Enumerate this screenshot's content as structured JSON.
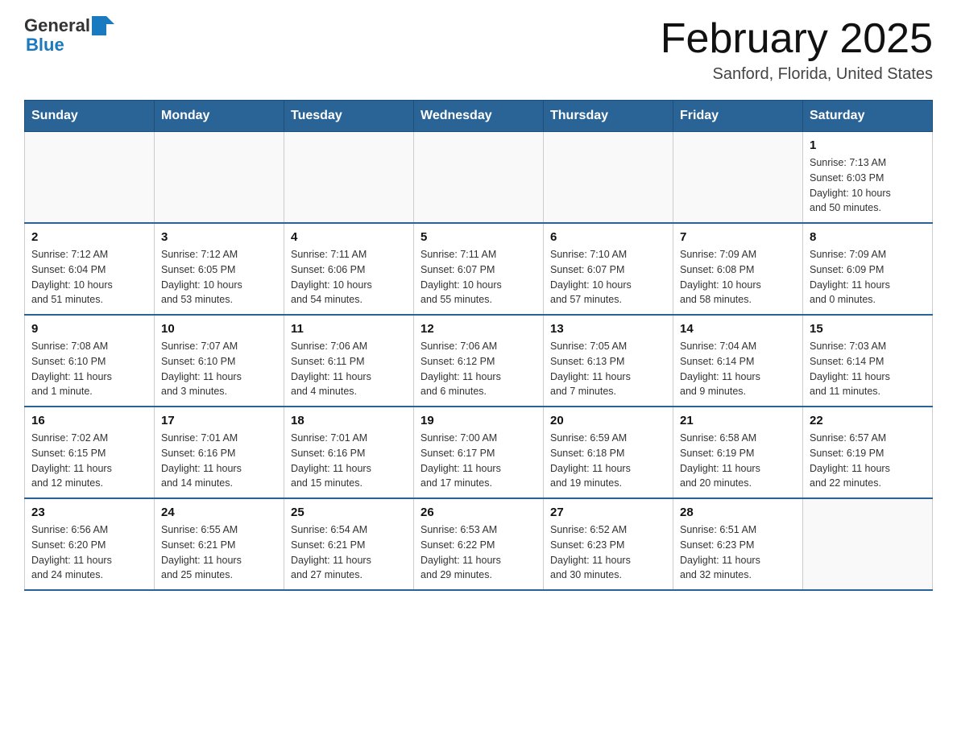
{
  "logo": {
    "general": "General",
    "blue": "Blue"
  },
  "title": "February 2025",
  "subtitle": "Sanford, Florida, United States",
  "days_of_week": [
    "Sunday",
    "Monday",
    "Tuesday",
    "Wednesday",
    "Thursday",
    "Friday",
    "Saturday"
  ],
  "weeks": [
    [
      {
        "day": "",
        "info": ""
      },
      {
        "day": "",
        "info": ""
      },
      {
        "day": "",
        "info": ""
      },
      {
        "day": "",
        "info": ""
      },
      {
        "day": "",
        "info": ""
      },
      {
        "day": "",
        "info": ""
      },
      {
        "day": "1",
        "info": "Sunrise: 7:13 AM\nSunset: 6:03 PM\nDaylight: 10 hours\nand 50 minutes."
      }
    ],
    [
      {
        "day": "2",
        "info": "Sunrise: 7:12 AM\nSunset: 6:04 PM\nDaylight: 10 hours\nand 51 minutes."
      },
      {
        "day": "3",
        "info": "Sunrise: 7:12 AM\nSunset: 6:05 PM\nDaylight: 10 hours\nand 53 minutes."
      },
      {
        "day": "4",
        "info": "Sunrise: 7:11 AM\nSunset: 6:06 PM\nDaylight: 10 hours\nand 54 minutes."
      },
      {
        "day": "5",
        "info": "Sunrise: 7:11 AM\nSunset: 6:07 PM\nDaylight: 10 hours\nand 55 minutes."
      },
      {
        "day": "6",
        "info": "Sunrise: 7:10 AM\nSunset: 6:07 PM\nDaylight: 10 hours\nand 57 minutes."
      },
      {
        "day": "7",
        "info": "Sunrise: 7:09 AM\nSunset: 6:08 PM\nDaylight: 10 hours\nand 58 minutes."
      },
      {
        "day": "8",
        "info": "Sunrise: 7:09 AM\nSunset: 6:09 PM\nDaylight: 11 hours\nand 0 minutes."
      }
    ],
    [
      {
        "day": "9",
        "info": "Sunrise: 7:08 AM\nSunset: 6:10 PM\nDaylight: 11 hours\nand 1 minute."
      },
      {
        "day": "10",
        "info": "Sunrise: 7:07 AM\nSunset: 6:10 PM\nDaylight: 11 hours\nand 3 minutes."
      },
      {
        "day": "11",
        "info": "Sunrise: 7:06 AM\nSunset: 6:11 PM\nDaylight: 11 hours\nand 4 minutes."
      },
      {
        "day": "12",
        "info": "Sunrise: 7:06 AM\nSunset: 6:12 PM\nDaylight: 11 hours\nand 6 minutes."
      },
      {
        "day": "13",
        "info": "Sunrise: 7:05 AM\nSunset: 6:13 PM\nDaylight: 11 hours\nand 7 minutes."
      },
      {
        "day": "14",
        "info": "Sunrise: 7:04 AM\nSunset: 6:14 PM\nDaylight: 11 hours\nand 9 minutes."
      },
      {
        "day": "15",
        "info": "Sunrise: 7:03 AM\nSunset: 6:14 PM\nDaylight: 11 hours\nand 11 minutes."
      }
    ],
    [
      {
        "day": "16",
        "info": "Sunrise: 7:02 AM\nSunset: 6:15 PM\nDaylight: 11 hours\nand 12 minutes."
      },
      {
        "day": "17",
        "info": "Sunrise: 7:01 AM\nSunset: 6:16 PM\nDaylight: 11 hours\nand 14 minutes."
      },
      {
        "day": "18",
        "info": "Sunrise: 7:01 AM\nSunset: 6:16 PM\nDaylight: 11 hours\nand 15 minutes."
      },
      {
        "day": "19",
        "info": "Sunrise: 7:00 AM\nSunset: 6:17 PM\nDaylight: 11 hours\nand 17 minutes."
      },
      {
        "day": "20",
        "info": "Sunrise: 6:59 AM\nSunset: 6:18 PM\nDaylight: 11 hours\nand 19 minutes."
      },
      {
        "day": "21",
        "info": "Sunrise: 6:58 AM\nSunset: 6:19 PM\nDaylight: 11 hours\nand 20 minutes."
      },
      {
        "day": "22",
        "info": "Sunrise: 6:57 AM\nSunset: 6:19 PM\nDaylight: 11 hours\nand 22 minutes."
      }
    ],
    [
      {
        "day": "23",
        "info": "Sunrise: 6:56 AM\nSunset: 6:20 PM\nDaylight: 11 hours\nand 24 minutes."
      },
      {
        "day": "24",
        "info": "Sunrise: 6:55 AM\nSunset: 6:21 PM\nDaylight: 11 hours\nand 25 minutes."
      },
      {
        "day": "25",
        "info": "Sunrise: 6:54 AM\nSunset: 6:21 PM\nDaylight: 11 hours\nand 27 minutes."
      },
      {
        "day": "26",
        "info": "Sunrise: 6:53 AM\nSunset: 6:22 PM\nDaylight: 11 hours\nand 29 minutes."
      },
      {
        "day": "27",
        "info": "Sunrise: 6:52 AM\nSunset: 6:23 PM\nDaylight: 11 hours\nand 30 minutes."
      },
      {
        "day": "28",
        "info": "Sunrise: 6:51 AM\nSunset: 6:23 PM\nDaylight: 11 hours\nand 32 minutes."
      },
      {
        "day": "",
        "info": ""
      }
    ]
  ]
}
